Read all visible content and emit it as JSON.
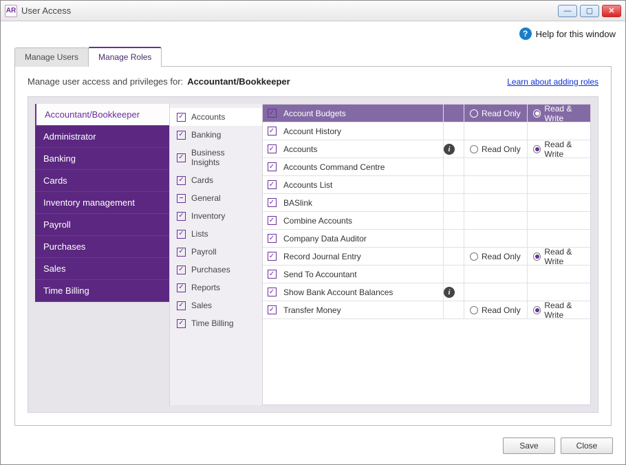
{
  "window": {
    "app_code": "AR",
    "title": "User Access"
  },
  "toolbar": {
    "help_label": "Help for this window"
  },
  "tabs": [
    {
      "label": "Manage Users",
      "active": false
    },
    {
      "label": "Manage Roles",
      "active": true
    }
  ],
  "header": {
    "prompt": "Manage user access and privileges for:",
    "role": "Accountant/Bookkeeper",
    "learn_link": "Learn about adding roles"
  },
  "roles": [
    {
      "label": "Accountant/Bookkeeper",
      "selected": true
    },
    {
      "label": "Administrator"
    },
    {
      "label": "Banking"
    },
    {
      "label": "Cards"
    },
    {
      "label": "Inventory management"
    },
    {
      "label": "Payroll"
    },
    {
      "label": "Purchases"
    },
    {
      "label": "Sales"
    },
    {
      "label": "Time Billing"
    }
  ],
  "categories": [
    {
      "label": "Accounts",
      "state": "check",
      "active": true
    },
    {
      "label": "Banking",
      "state": "check"
    },
    {
      "label": "Business Insights",
      "state": "check"
    },
    {
      "label": "Cards",
      "state": "check"
    },
    {
      "label": "General",
      "state": "dash"
    },
    {
      "label": "Inventory",
      "state": "check"
    },
    {
      "label": "Lists",
      "state": "check"
    },
    {
      "label": "Payroll",
      "state": "check"
    },
    {
      "label": "Purchases",
      "state": "check"
    },
    {
      "label": "Reports",
      "state": "check"
    },
    {
      "label": "Sales",
      "state": "check"
    },
    {
      "label": "Time Billing",
      "state": "check"
    }
  ],
  "radio_labels": {
    "ro": "Read Only",
    "rw": "Read & Write"
  },
  "permissions": [
    {
      "label": "Account Budgets",
      "checked": true,
      "header": true,
      "ro": false,
      "rw": true,
      "show_radios": true
    },
    {
      "label": "Account History",
      "checked": true
    },
    {
      "label": "Accounts",
      "checked": true,
      "info": true,
      "ro": false,
      "rw": true,
      "show_radios": true
    },
    {
      "label": "Accounts Command Centre",
      "checked": true
    },
    {
      "label": "Accounts List",
      "checked": true
    },
    {
      "label": "BASlink",
      "checked": true
    },
    {
      "label": "Combine Accounts",
      "checked": true
    },
    {
      "label": "Company Data Auditor",
      "checked": true
    },
    {
      "label": "Record Journal Entry",
      "checked": true,
      "ro": false,
      "rw": true,
      "show_radios": true
    },
    {
      "label": "Send To Accountant",
      "checked": true
    },
    {
      "label": "Show Bank Account Balances",
      "checked": true,
      "info": true
    },
    {
      "label": "Transfer Money",
      "checked": true,
      "ro": false,
      "rw": true,
      "show_radios": true
    }
  ],
  "footer": {
    "save": "Save",
    "close": "Close"
  }
}
